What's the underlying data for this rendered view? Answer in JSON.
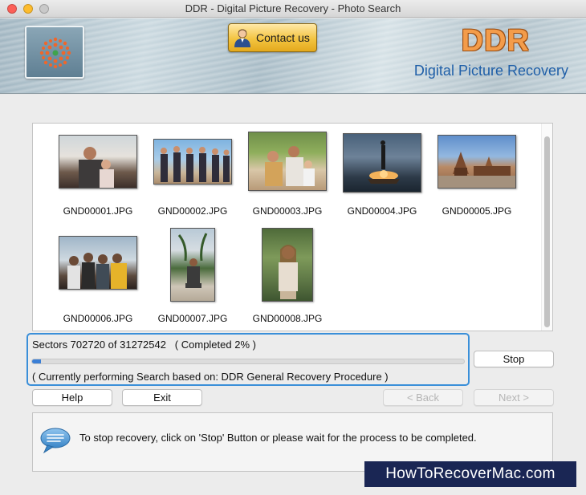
{
  "window": {
    "title": "DDR - Digital Picture Recovery - Photo Search"
  },
  "header": {
    "contact_label": "Contact us",
    "brand": "DDR",
    "subtitle": "Digital Picture Recovery",
    "brand_color": "#f39c4a",
    "subtitle_color": "#1f5fa8"
  },
  "gallery": {
    "files": [
      {
        "name": "GND00001.JPG",
        "icon": "photo-thumbnail"
      },
      {
        "name": "GND00002.JPG",
        "icon": "photo-thumbnail"
      },
      {
        "name": "GND00003.JPG",
        "icon": "photo-thumbnail"
      },
      {
        "name": "GND00004.JPG",
        "icon": "photo-thumbnail"
      },
      {
        "name": "GND00005.JPG",
        "icon": "photo-thumbnail"
      },
      {
        "name": "GND00006.JPG",
        "icon": "photo-thumbnail"
      },
      {
        "name": "GND00007.JPG",
        "icon": "photo-thumbnail"
      },
      {
        "name": "GND00008.JPG",
        "icon": "photo-thumbnail"
      }
    ]
  },
  "progress": {
    "sectors_text": "Sectors 702720 of 31272542   ( Completed 2% )",
    "percent": 2,
    "procedure_text": "( Currently performing Search based on: DDR General Recovery Procedure )",
    "accent": "#3a8fd9"
  },
  "buttons": {
    "stop": "Stop",
    "help": "Help",
    "exit": "Exit",
    "back": "< Back",
    "next": "Next >"
  },
  "info": {
    "message": "To stop recovery, click on 'Stop' Button or please wait for the process to be completed."
  },
  "watermark": {
    "text": "HowToRecoverMac.com"
  }
}
